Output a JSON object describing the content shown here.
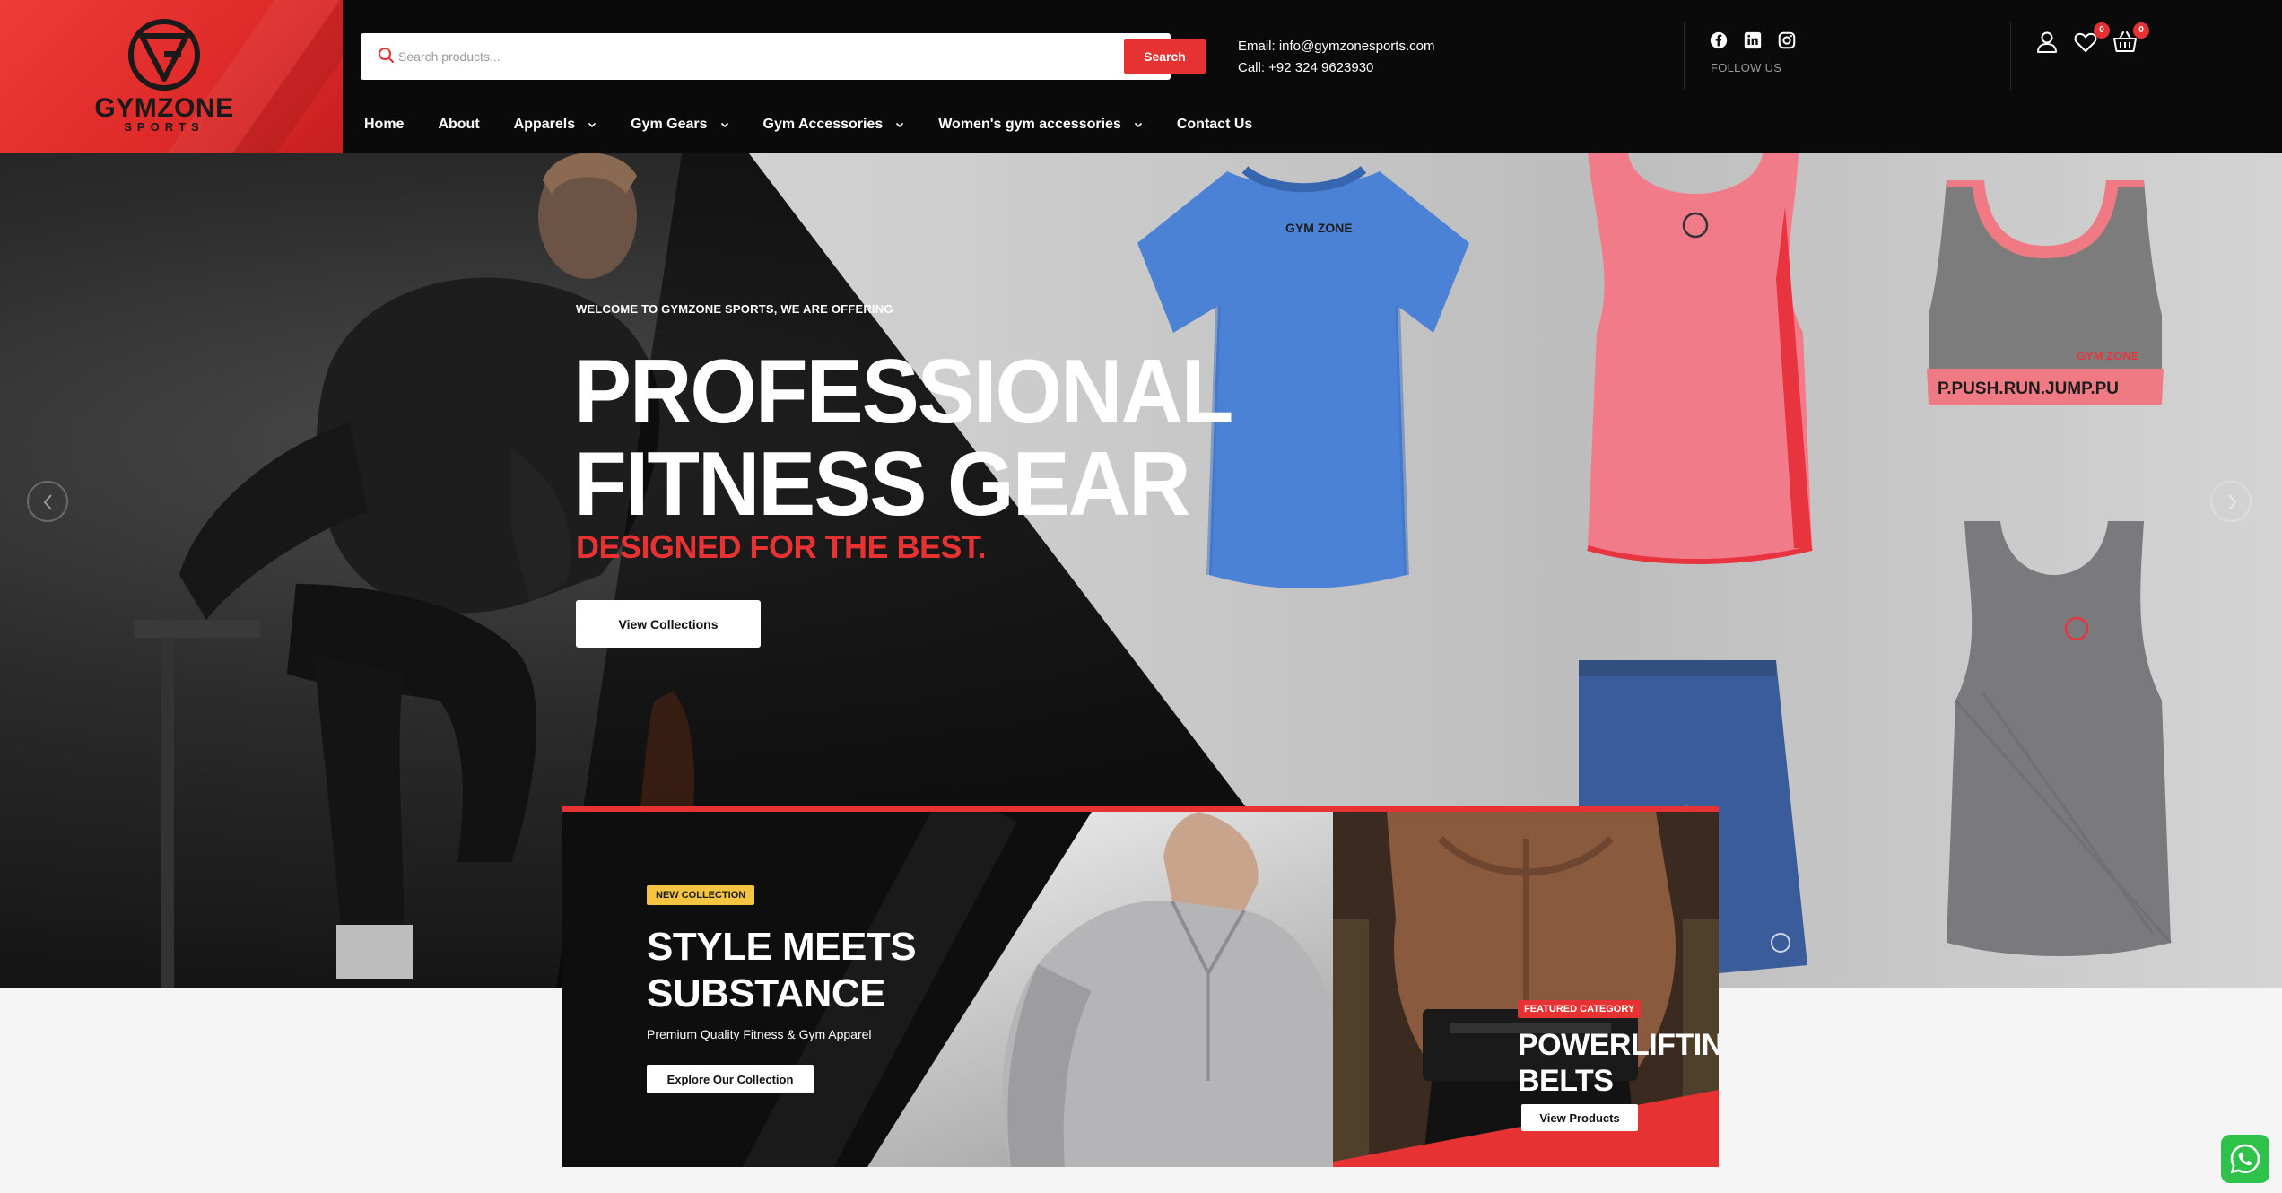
{
  "brand": {
    "name": "GYMZONE",
    "sub": "SPORTS"
  },
  "search": {
    "placeholder": "Search products...",
    "button": "Search"
  },
  "contact": {
    "email": "Email: info@gymzonesports.com",
    "phone": "Call:  +92 324 9623930"
  },
  "social": {
    "icons": [
      "facebook-icon",
      "linkedin-icon",
      "instagram-icon"
    ],
    "label": "FOLLOW US"
  },
  "header_icons": {
    "wishlist_count": "0",
    "cart_count": "0"
  },
  "nav": [
    {
      "label": "Home",
      "dropdown": false
    },
    {
      "label": "About",
      "dropdown": false
    },
    {
      "label": "Apparels",
      "dropdown": true
    },
    {
      "label": "Gym Gears",
      "dropdown": true
    },
    {
      "label": "Gym Accessories",
      "dropdown": true
    },
    {
      "label": "Women's gym accessories",
      "dropdown": true
    },
    {
      "label": "Contact Us",
      "dropdown": false
    }
  ],
  "hero": {
    "eyebrow": "WELCOME TO GYMZONE SPORTS, WE ARE OFFERING",
    "title_line1": "PROFESSIONAL",
    "title_line2": "FITNESS GEAR",
    "subtitle": "DESIGNED FOR THE BEST.",
    "button": "View Collections",
    "garment_texts": {
      "tee_logo": "GYM ZONE",
      "bra_band": "P.PUSH.RUN.JUMP.PU",
      "bra_logo": "GYM ZONE"
    }
  },
  "promo": {
    "left": {
      "tag": "NEW COLLECTION",
      "title_line1": "STYLE MEETS",
      "title_line2": "SUBSTANCE",
      "text": "Premium Quality Fitness & Gym Apparel",
      "button": "Explore Our Collection"
    },
    "right": {
      "tag": "FEATURED CATEGORY",
      "title_line1": "POWERLIFTING",
      "title_line2": "BELTS",
      "button": "View Products"
    }
  },
  "colors": {
    "accent": "#e63232",
    "dark": "#0a0a0a",
    "tag_yellow": "#f5c542",
    "whatsapp": "#2ec24b"
  }
}
